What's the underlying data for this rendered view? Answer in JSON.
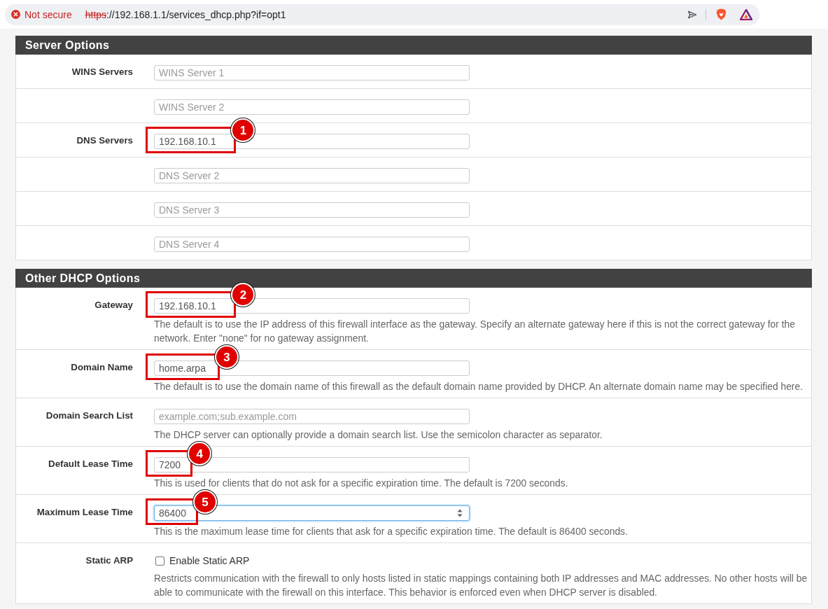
{
  "address_bar": {
    "security_label": "Not secure",
    "url_scheme": "https",
    "url_rest": "://192.168.1.1/services_dhcp.php?if=opt1"
  },
  "sections": [
    {
      "title": "Server Options",
      "rows": [
        {
          "kind": "input",
          "label": "WINS Servers",
          "field": {
            "placeholder": "WINS Server 1",
            "focused": false
          }
        },
        {
          "kind": "input",
          "field": {
            "placeholder": "WINS Server 2",
            "focused": false
          }
        },
        {
          "kind": "input",
          "label": "DNS Servers",
          "field": {
            "value": "192.168.10.1",
            "focused": false,
            "callout": "1"
          }
        },
        {
          "kind": "input",
          "field": {
            "placeholder": "DNS Server 2",
            "focused": false
          }
        },
        {
          "kind": "input",
          "field": {
            "placeholder": "DNS Server 3",
            "focused": false
          }
        },
        {
          "kind": "input",
          "field": {
            "placeholder": "DNS Server 4",
            "focused": false
          }
        }
      ]
    },
    {
      "title": "Other DHCP Options",
      "rows": [
        {
          "kind": "input",
          "label": "Gateway",
          "field": {
            "value": "192.168.10.1",
            "focused": false,
            "callout": "2"
          },
          "help": "The default is to use the IP address of this firewall interface as the gateway. Specify an alternate gateway here if this is not the correct gateway for the network. Enter \"none\" for no gateway assignment."
        },
        {
          "kind": "input",
          "label": "Domain Name",
          "field": {
            "value": "home.arpa",
            "focused": false,
            "callout": "3"
          },
          "help": "The default is to use the domain name of this firewall as the default domain name provided by DHCP. An alternate domain name may be specified here."
        },
        {
          "kind": "input",
          "label": "Domain Search List",
          "field": {
            "placeholder": "example.com;sub.example.com",
            "focused": false
          },
          "help": "The DHCP server can optionally provide a domain search list. Use the semicolon character as separator."
        },
        {
          "kind": "input",
          "label": "Default Lease Time",
          "field": {
            "value": "7200",
            "focused": false,
            "callout": "4"
          },
          "help": "This is used for clients that do not ask for a specific expiration time. The default is 7200 seconds."
        },
        {
          "kind": "input",
          "label": "Maximum Lease Time",
          "field": {
            "value": "86400",
            "focused": true,
            "callout": "5"
          },
          "help": "This is the maximum lease time for clients that ask for a specific expiration time. The default is 86400 seconds."
        },
        {
          "kind": "checkbox",
          "label": "Static ARP",
          "checkbox": {
            "text": "Enable Static ARP",
            "checked": false
          },
          "help": "Restricts communication with the firewall to only hosts listed in static mappings containing both IP addresses and MAC addresses. No other hosts will be able to communicate with the firewall on this interface. This behavior is enforced even when DHCP server is disabled."
        }
      ]
    }
  ]
}
